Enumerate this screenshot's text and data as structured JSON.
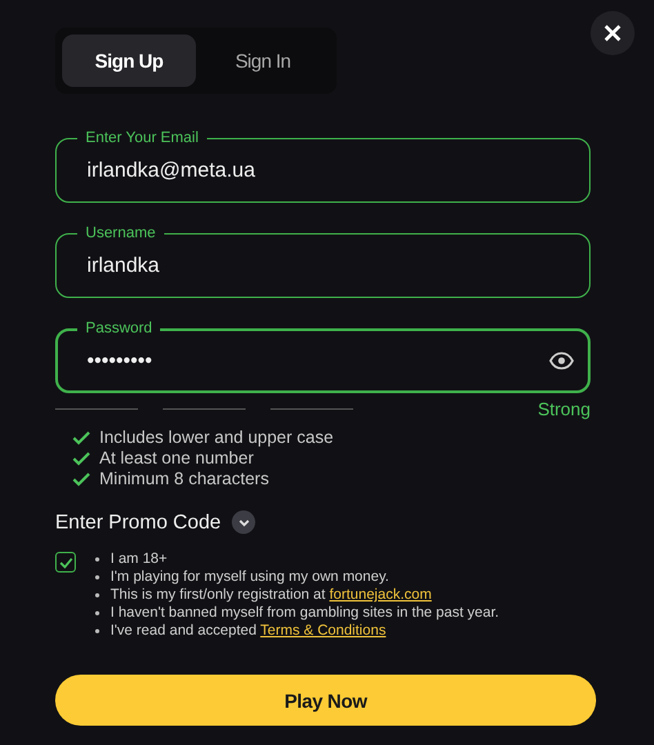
{
  "tabs": [
    {
      "label": "Sign Up",
      "selected": true
    },
    {
      "label": "Sign In",
      "selected": false
    }
  ],
  "fields": [
    {
      "label": "Enter Your Email",
      "value": "irlandka@meta.ua",
      "kind": "text"
    },
    {
      "label": "Username",
      "value": "irlandka",
      "kind": "text"
    },
    {
      "label": "Password",
      "value": "•••••••••",
      "kind": "password"
    }
  ],
  "strength": {
    "label": "Strong"
  },
  "requirements": [
    {
      "text": "Includes lower and upper case",
      "met": true
    },
    {
      "text": "At least one number",
      "met": true
    },
    {
      "text": "Minimum 8 characters",
      "met": true
    }
  ],
  "promo": {
    "label": "Enter Promo Code",
    "expanded": false
  },
  "terms": {
    "checked": true,
    "items": [
      {
        "text": "I am 18+"
      },
      {
        "text": "I'm playing for myself using my own money."
      },
      {
        "text": "This is my first/only registration at",
        "link": "fortunejack.com"
      },
      {
        "text": "I haven't banned myself from gambling sites in the past year."
      },
      {
        "text": "I've read and accepted",
        "link": "Terms & Conditions"
      }
    ]
  },
  "submit": "Play Now"
}
